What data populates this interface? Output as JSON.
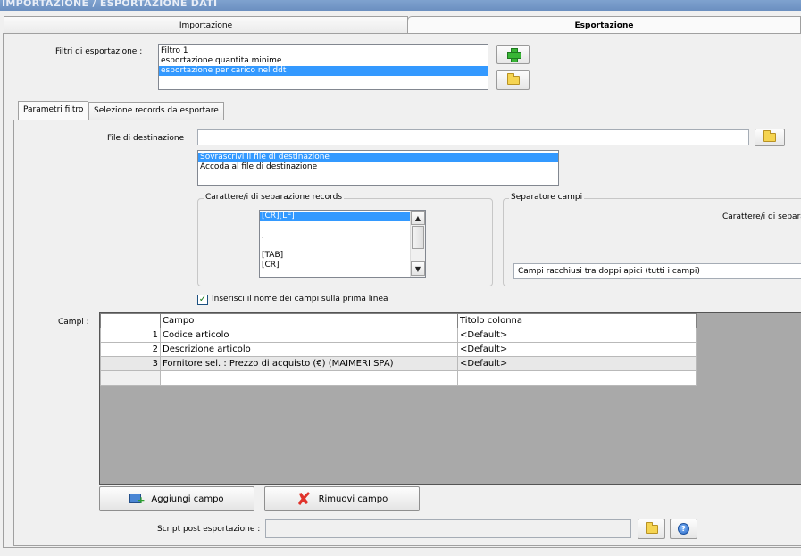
{
  "window": {
    "title": "IMPORTAZIONE / ESPORTAZIONE DATI"
  },
  "main_tabs": [
    {
      "label": "Importazione"
    },
    {
      "label": "Esportazione"
    }
  ],
  "export_filters": {
    "label": "Filtri di esportazione :",
    "items": [
      "Filtro 1",
      "esportazione quantita minime",
      "esportazione per carico nel ddt"
    ],
    "selected_index": 2
  },
  "sub_tabs": [
    {
      "label": "Parametri filtro"
    },
    {
      "label": "Selezione records da esportare"
    }
  ],
  "destination": {
    "label": "File di destinazione :",
    "value": "",
    "mode_options": [
      "Sovrascrivi il file di destinazione",
      "Accoda al file di destinazione"
    ],
    "mode_selected_index": 0
  },
  "record_separator": {
    "legend": "Carattere/i di separazione records",
    "options": [
      "[CR][LF]",
      ";",
      ",",
      "|",
      "[TAB]",
      "[CR]"
    ],
    "selected_index": 0
  },
  "field_separator": {
    "legend": "Separatore campi",
    "chars_label": "Carattere/i di separa",
    "quote_mode": "Campi racchiusi tra doppi apici (tutti i campi)"
  },
  "header_checkbox": {
    "label": "Inserisci il nome dei campi sulla prima linea",
    "checked": true
  },
  "fields_grid": {
    "label": "Campi :",
    "columns": [
      "",
      "Campo",
      "Titolo colonna"
    ],
    "rows": [
      {
        "num": "1",
        "campo": "Codice articolo",
        "titolo": "<Default>"
      },
      {
        "num": "2",
        "campo": "Descrizione articolo",
        "titolo": "<Default>"
      },
      {
        "num": "3",
        "campo": "Fornitore sel. : Prezzo di acquisto (€) (MAIMERI SPA)",
        "titolo": "<Default>"
      }
    ]
  },
  "buttons": {
    "add_field": "Aggiungi campo",
    "remove_field": "Rimuovi campo"
  },
  "post_script": {
    "label": "Script post esportazione :",
    "value": ""
  },
  "icons": {
    "add_filter": "plus-icon",
    "open_filter": "folder-icon",
    "browse_destination": "folder-icon",
    "browse_script": "folder-icon",
    "help": "help-icon"
  }
}
